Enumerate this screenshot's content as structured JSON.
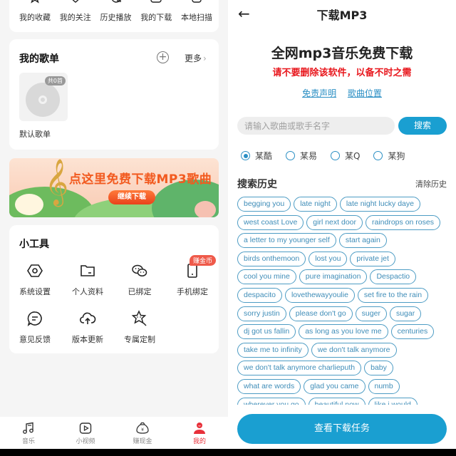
{
  "left": {
    "quick_items": [
      {
        "label": "我的收藏",
        "icon": "star-icon"
      },
      {
        "label": "我的关注",
        "icon": "heart-icon"
      },
      {
        "label": "历史播放",
        "icon": "history-icon"
      },
      {
        "label": "我的下载",
        "icon": "download-icon"
      },
      {
        "label": "本地扫描",
        "icon": "scan-icon"
      }
    ],
    "playlist": {
      "title": "我的歌单",
      "add_icon": "plus-circle-icon",
      "more_label": "更多",
      "more_chevron": "›",
      "items": [
        {
          "name": "默认歌单",
          "count": "共0首"
        }
      ]
    },
    "banner": {
      "headline": "点这里免费下载MP3歌曲",
      "button": "继续下载",
      "clef": "𝄞"
    },
    "tools": {
      "title": "小工具",
      "items": [
        {
          "label": "系统设置",
          "icon": "settings-icon"
        },
        {
          "label": "个人资料",
          "icon": "folder-icon"
        },
        {
          "label": "已绑定",
          "icon": "wechat-icon"
        },
        {
          "label": "手机绑定",
          "icon": "phone-icon",
          "badge": "赚金币"
        },
        {
          "label": "意见反馈",
          "icon": "feedback-icon"
        },
        {
          "label": "版本更新",
          "icon": "cloud-upload-icon"
        },
        {
          "label": "专属定制",
          "icon": "star-custom-icon"
        }
      ]
    },
    "tabbar": {
      "tabs": [
        {
          "label": "音乐",
          "icon": "music-note-icon",
          "active": false
        },
        {
          "label": "小视频",
          "icon": "video-play-icon",
          "active": false
        },
        {
          "label": "赚现金",
          "icon": "money-bag-icon",
          "active": false
        },
        {
          "label": "我的",
          "icon": "user-icon",
          "active": true
        }
      ],
      "active_color": "#e8303a"
    }
  },
  "right": {
    "back_icon": "←",
    "title": "下载MP3",
    "headline": "全网mp3音乐免费下载",
    "warning": "请不要删除该软件，以备不时之需",
    "links": [
      "免责声明",
      "歌曲位置"
    ],
    "search": {
      "placeholder": "请输入歌曲或歌手名字",
      "value": "",
      "button": "搜索"
    },
    "sources": [
      {
        "label": "某酷",
        "selected": true
      },
      {
        "label": "某易",
        "selected": false
      },
      {
        "label": "某Q",
        "selected": false
      },
      {
        "label": "某狗",
        "selected": false
      }
    ],
    "history": {
      "title": "搜索历史",
      "clear": "清除历史",
      "rows": [
        [
          "begging you",
          "late night",
          "late night lucky daye"
        ],
        [
          "west coast Love",
          "girl next door",
          "raindrops on roses"
        ],
        [
          "a letter to my younger self",
          "start again"
        ],
        [
          "birds onthemoon",
          "lost you",
          "private jet"
        ],
        [
          "cool you mine",
          "pure imagination",
          "Despactio"
        ],
        [
          "despacito",
          "lovethewayyoulie",
          "set fire to the rain"
        ],
        [
          "sorry justin",
          "please don't go",
          "suger",
          "sugar"
        ],
        [
          "dj got us fallin",
          "as long as you love me",
          "centuries"
        ],
        [
          "take me to infinity",
          "we don't talk anymore"
        ],
        [
          "we don't talk anymore charlieputh",
          "baby"
        ],
        [
          "what are words",
          "glad you came",
          "numb"
        ],
        [
          "wherever you go",
          "beautiful now",
          "like i would"
        ]
      ]
    },
    "view_tasks_button": "查看下载任务",
    "accent_color": "#1a9fd1",
    "warning_color": "#e8161c"
  }
}
